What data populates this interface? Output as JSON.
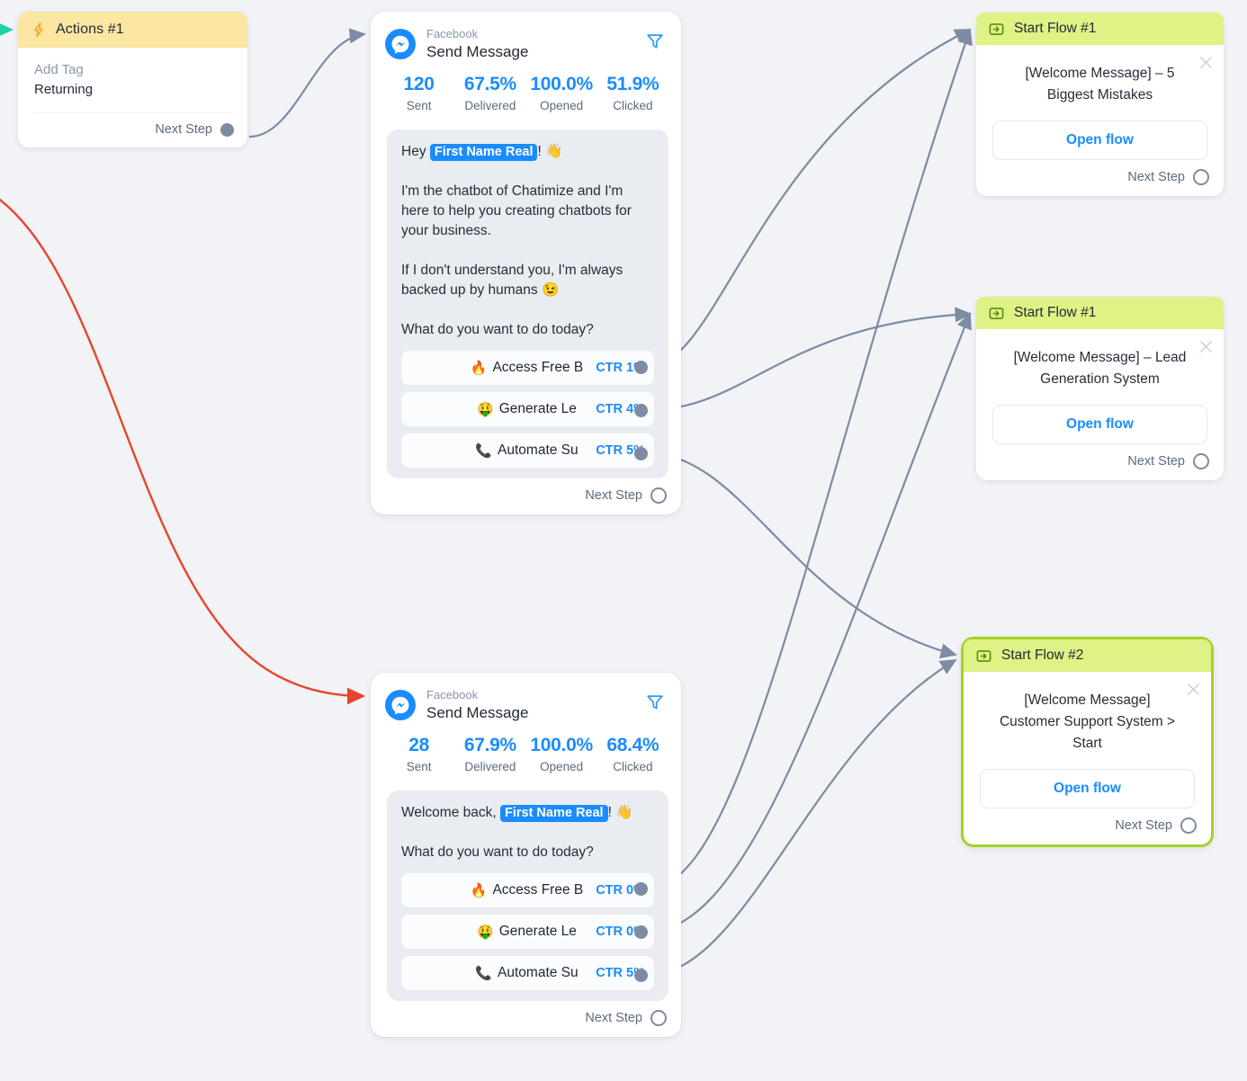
{
  "canvas": {
    "background": "#f1f3f6",
    "accent_blue": "#1a8cff",
    "edge_color": "#7d8ba3",
    "highlight_red": "#e8452c",
    "entry_arrow_color": "#1fd1a5",
    "flow_header_green": "#dff286",
    "flow_selected_border": "#a4d326",
    "actions_header_yellow": "#fbe6a2"
  },
  "actions_node": {
    "icon": "lightning-bolt-icon",
    "title": "Actions #1",
    "action_label": "Add Tag",
    "action_value": "Returning",
    "next_step_label": "Next Step"
  },
  "message_nodes": [
    {
      "platform": "Facebook",
      "title": "Send Message",
      "filter_icon": "funnel-icon",
      "stats": [
        {
          "value": "120",
          "label": "Sent"
        },
        {
          "value": "67.5%",
          "label": "Delivered"
        },
        {
          "value": "100.0%",
          "label": "Opened"
        },
        {
          "value": "51.9%",
          "label": "Clicked"
        }
      ],
      "bubble": {
        "greeting_prefix": "Hey ",
        "greeting_token": "First Name Real",
        "greeting_suffix": "! 👋",
        "paragraphs": [
          "I'm the chatbot of Chatimize and I'm here to help you creating chatbots for your business.",
          "If I don't understand you, I'm always backed up by humans 😉",
          "What do you want to do today?"
        ]
      },
      "buttons": [
        {
          "emoji": "🔥",
          "label": "Access Free B",
          "ctr": "CTR 1%"
        },
        {
          "emoji": "🤑",
          "label": "Generate Le",
          "ctr": "CTR 4%"
        },
        {
          "emoji": "📞",
          "label": "Automate Su",
          "ctr": "CTR 5%"
        }
      ],
      "next_step_label": "Next Step"
    },
    {
      "platform": "Facebook",
      "title": "Send Message",
      "filter_icon": "funnel-icon",
      "stats": [
        {
          "value": "28",
          "label": "Sent"
        },
        {
          "value": "67.9%",
          "label": "Delivered"
        },
        {
          "value": "100.0%",
          "label": "Opened"
        },
        {
          "value": "68.4%",
          "label": "Clicked"
        }
      ],
      "bubble": {
        "greeting_prefix": "Welcome back, ",
        "greeting_token": "First Name Real",
        "greeting_suffix": "! 👋",
        "paragraphs": [
          "What do you want to do today?"
        ]
      },
      "buttons": [
        {
          "emoji": "🔥",
          "label": "Access Free B",
          "ctr": "CTR 0%"
        },
        {
          "emoji": "🤑",
          "label": "Generate Le",
          "ctr": "CTR 0%"
        },
        {
          "emoji": "📞",
          "label": "Automate Su",
          "ctr": "CTR 5%"
        }
      ],
      "next_step_label": "Next Step"
    }
  ],
  "flow_nodes": [
    {
      "icon": "start-flow-icon",
      "title": "Start Flow #1",
      "description": "[Welcome Message] – 5 Biggest Mistakes",
      "open_flow_label": "Open flow",
      "next_step_label": "Next Step",
      "close_icon": "close-icon",
      "selected": false
    },
    {
      "icon": "start-flow-icon",
      "title": "Start Flow #1",
      "description": "[Welcome Message] – Lead Generation System",
      "open_flow_label": "Open flow",
      "next_step_label": "Next Step",
      "close_icon": "close-icon",
      "selected": false
    },
    {
      "icon": "start-flow-icon",
      "title": "Start Flow #2",
      "description": "[Welcome Message] Customer Support System > Start",
      "open_flow_label": "Open flow",
      "next_step_label": "Next Step",
      "close_icon": "close-icon",
      "selected": true
    }
  ]
}
